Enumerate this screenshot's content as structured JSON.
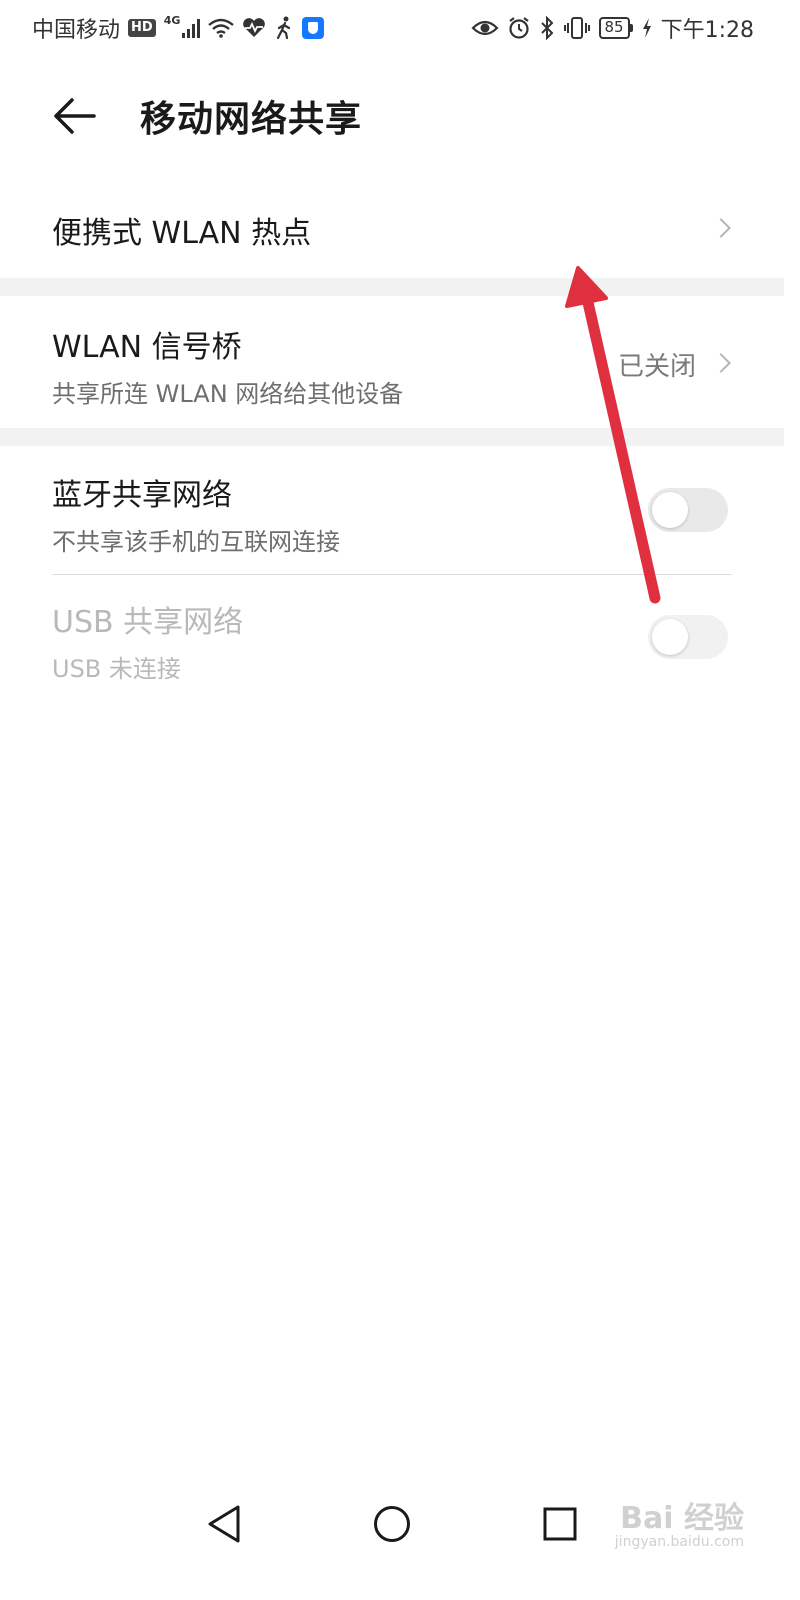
{
  "status_bar": {
    "carrier": "中国移动",
    "hd": "HD",
    "network": "4G",
    "battery": "85",
    "time": "下午1:28",
    "icons": [
      "hd-badge",
      "signal-icon",
      "wifi-icon",
      "heart-rate-icon",
      "walking-icon",
      "shield-icon",
      "eye-icon",
      "alarm-icon",
      "bluetooth-icon",
      "vibrate-icon",
      "battery-icon",
      "charging-icon"
    ]
  },
  "header": {
    "back_icon": "back-arrow-icon",
    "title": "移动网络共享"
  },
  "items": [
    {
      "title": "便携式 WLAN 热点",
      "type": "link"
    },
    {
      "title": "WLAN 信号桥",
      "subtitle": "共享所连 WLAN 网络给其他设备",
      "status": "已关闭",
      "type": "link"
    },
    {
      "title": "蓝牙共享网络",
      "subtitle": "不共享该手机的互联网连接",
      "type": "toggle",
      "checked": false
    },
    {
      "title": "USB 共享网络",
      "subtitle": "USB 未连接",
      "type": "toggle",
      "checked": false,
      "disabled": true
    }
  ],
  "annotation": {
    "type": "arrow",
    "color": "#e0303f",
    "points_to": "便携式 WLAN 热点"
  },
  "nav_bar": {
    "icons": [
      "back-triangle-icon",
      "home-circle-icon",
      "recents-square-icon"
    ]
  },
  "watermark": {
    "text": "Bai 经验",
    "sub": "jingyan.baidu.com"
  }
}
